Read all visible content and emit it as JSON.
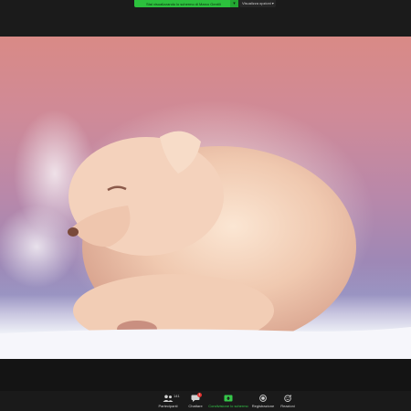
{
  "top_bar": {
    "share_banner_text": "Stai visualizzando lo schermo di Marco Gentili",
    "share_banner_caret": "▾",
    "view_options_label": "Visualizza opzioni",
    "view_options_caret": "▾"
  },
  "toolbar": {
    "participants": {
      "label": "Partecipanti",
      "count": "141",
      "icon": "people-icon"
    },
    "chat": {
      "label": "Chattare",
      "badge": "1",
      "icon": "chat-icon"
    },
    "share_screen": {
      "label": "Condivisione lo schermo",
      "icon": "share-screen-icon",
      "color": "#35c64a"
    },
    "record": {
      "label": "Registrazione",
      "icon": "record-icon"
    },
    "reactions": {
      "label": "Reazioni",
      "icon": "reactions-icon"
    }
  },
  "colors": {
    "accent_green": "#2cc13d",
    "toolbar_bg": "#1a1a1a",
    "badge_red": "#e0312f"
  }
}
